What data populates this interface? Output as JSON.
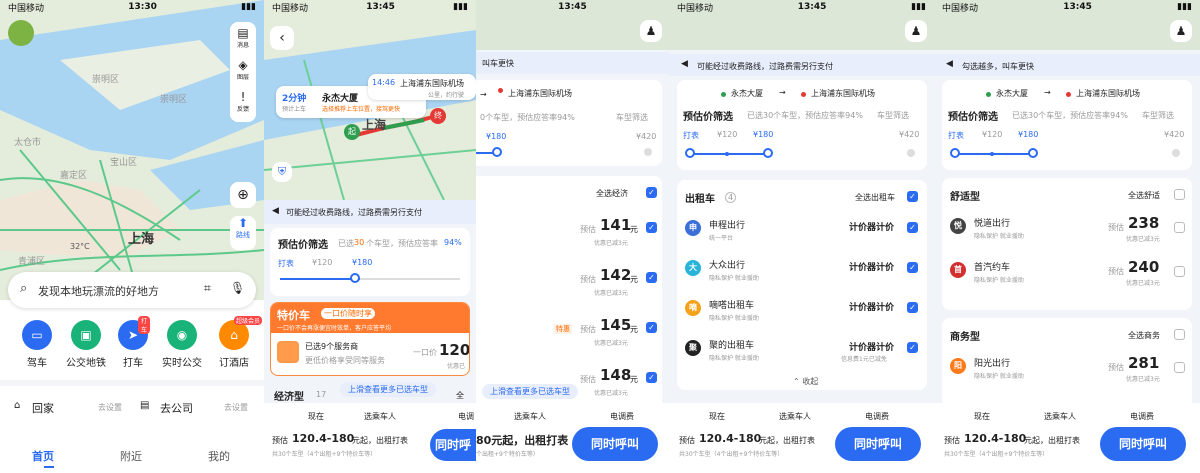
{
  "p1": {
    "carrier": "中国移动",
    "time": "13:30",
    "side": [
      "消息",
      "图层",
      "反馈"
    ],
    "map_labels": [
      "崇明区",
      "崇明区",
      "太仓市",
      "宝山区",
      "嘉定区",
      "上海",
      "青浦区"
    ],
    "weather": "32°C",
    "route_label": "路线",
    "search_placeholder": "发现本地玩漂流的好地方",
    "quick": [
      "驾车",
      "公交地铁",
      "打车",
      "实时公交",
      "订酒店"
    ],
    "badge1": "打车",
    "badge2": "超级会员",
    "home": "回家",
    "home_set": "去设置",
    "work": "去公司",
    "work_set": "去设置",
    "nav": [
      "首页",
      "附近",
      "我的"
    ]
  },
  "p2": {
    "carrier": "中国移动",
    "time": "13:45",
    "eta": "2分钟",
    "eta_sub": "预计上车",
    "start": "永杰大厦",
    "start_sub": "选择推荐上车位置，接驾更快",
    "dest_time": "14:46",
    "dest": "上海浦东国际机场",
    "dest_sub": "公里，约行驶",
    "map_city": "上海",
    "pin_start": "起",
    "pin_end": "终",
    "notice": "可能经过收费路线，过路费需另行支付",
    "filter_title": "预估价筛选",
    "filter_sub_pre": "已选",
    "filter_count": "30",
    "filter_sub_post": "个车型，预估应答率",
    "filter_rate": "94%",
    "scale": [
      "打表",
      "¥120",
      "¥180"
    ],
    "special_title": "特价车",
    "special_tag": "一口价随时享",
    "special_sub": "一口价不会再涨便宜时效单，客户应答平均",
    "special_row1": "已选9个服务商",
    "special_row2": "更低价格享受同等服务",
    "special_price_label": "一口价",
    "special_price": "120.",
    "special_discount": "优惠已",
    "eco_title": "经济型",
    "eco_count": "17",
    "eco_all": "全",
    "more": "上滑查看更多已选车型",
    "tabs": [
      "现在",
      "选乘车人",
      "电调"
    ],
    "est_pre": "预估",
    "est_range": "120.4-180",
    "est_post": "元起，出租打表",
    "est_sub": "共30个车型（4个出租+9个特价车等）",
    "call": "同时呼叫"
  },
  "p3": {
    "time": "13:45",
    "notice": "叫车更快",
    "dest": "上海浦东国际机场",
    "filter_sub": "0个车型，预估应答率94%",
    "filter_tag": "车型筛选",
    "scale": [
      "¥180",
      "¥420"
    ],
    "select_all": "全选经济",
    "rows": [
      {
        "label": "预估",
        "price": "141",
        "unit": "元",
        "disc": "优惠已减3元",
        "tag": ""
      },
      {
        "label": "预估",
        "price": "142",
        "unit": "元",
        "disc": "优惠已减3元",
        "tag": ""
      },
      {
        "label": "预估",
        "price": "145",
        "unit": "元",
        "disc": "优惠已减3元",
        "tag": "特惠"
      },
      {
        "label": "预估",
        "price": "148",
        "unit": "元",
        "disc": "优惠已减3元",
        "tag": ""
      }
    ],
    "more": "上滑查看更多已选车型",
    "tabs": [
      "选乘车人",
      "电调费"
    ],
    "est_range": "80元起，出租打表",
    "est_sub": "个出租+9个特价车等）",
    "call": "同时呼叫"
  },
  "p4": {
    "carrier": "中国移动",
    "time": "13:45",
    "notice": "可能经过收费路线，过路费需另行支付",
    "start": "永杰大厦",
    "dest": "上海浦东国际机场",
    "filter_title": "预估价筛选",
    "filter_sub": "已选30个车型，预估应答率94%",
    "filter_tag": "车型筛选",
    "scale": [
      "打表",
      "¥120",
      "¥180",
      "¥420"
    ],
    "section": "出租车",
    "section_count": "4",
    "select_all": "全选出租车",
    "rows": [
      {
        "name": "申程出行",
        "sub": "统一平台",
        "price": "计价器计价",
        "logo": "#3a6fd8",
        "ch": "申"
      },
      {
        "name": "大众出行",
        "sub": "隐私保护  就业援助",
        "price": "计价器计价",
        "logo": "#27b4d8",
        "ch": "大"
      },
      {
        "name": "嘀嗒出租车",
        "sub": "隐私保护  就业援助",
        "price": "计价器计价",
        "logo": "#f5a21b",
        "ch": "嘀"
      },
      {
        "name": "聚的出租车",
        "sub": "隐私保护  就业援助",
        "price": "计价器计价",
        "logo": "#222222",
        "ch": "聚",
        "disc": "信息费1元已减免"
      }
    ],
    "collapse": "收起",
    "tabs": [
      "现在",
      "选乘车人",
      "电调费"
    ],
    "est_pre": "预估",
    "est_range": "120.4-180",
    "est_post": "元起，出租打表",
    "est_sub": "共30个车型（4个出租+9个特价车等）",
    "call": "同时呼叫"
  },
  "p5": {
    "carrier": "中国移动",
    "time": "13:45",
    "notice": "勾选越多，叫车更快",
    "start": "永杰大厦",
    "dest": "上海浦东国际机场",
    "filter_title": "预估价筛选",
    "filter_sub": "已选30个车型，预估应答率94%",
    "filter_tag": "车型筛选",
    "scale": [
      "打表",
      "¥120",
      "¥180",
      "¥420"
    ],
    "sec1": "舒适型",
    "sec1_all": "全选舒适",
    "sec1_rows": [
      {
        "name": "悦道出行",
        "sub": "隐私保护  就业援助",
        "label": "预估",
        "price": "238",
        "disc": "优惠已减3元",
        "logo": "#444444",
        "ch": "悦"
      },
      {
        "name": "首汽约车",
        "sub": "隐私保护  就业援助",
        "label": "预估",
        "price": "240",
        "disc": "优惠已减3元",
        "logo": "#d32f2f",
        "ch": "首"
      }
    ],
    "sec2": "商务型",
    "sec2_all": "全选商务",
    "sec2_rows": [
      {
        "name": "阳光出行",
        "sub": "隐私保护  就业援助",
        "label": "预估",
        "price": "281",
        "disc": "优惠已减3元",
        "logo": "#ff7a1a",
        "ch": "阳"
      }
    ],
    "tabs": [
      "现在",
      "选乘车人",
      "电调费"
    ],
    "est_pre": "预估",
    "est_range": "120.4-180",
    "est_post": "元起，出租打表",
    "est_sub": "共30个车型（4个出租+9个特价车等）",
    "call": "同时呼叫"
  },
  "colors": {
    "primary": "#2a6bf2",
    "orange": "#ff6a00"
  }
}
